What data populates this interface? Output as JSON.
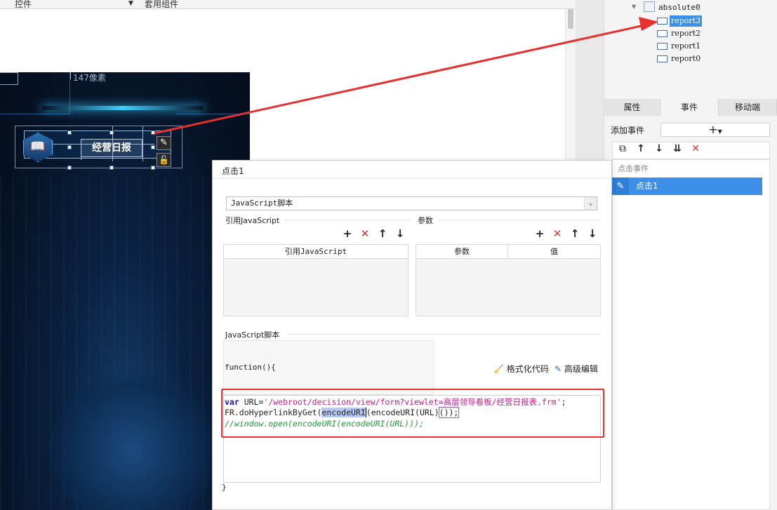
{
  "topbar": {
    "left_label": "控件",
    "right_label": "套用组件"
  },
  "canvas": {
    "pixel_label": "147像素"
  },
  "widget": {
    "title": "经营日报"
  },
  "tree": {
    "root": "absolute0",
    "items": [
      {
        "label": "report3",
        "selected": true
      },
      {
        "label": "report2",
        "selected": false
      },
      {
        "label": "report1",
        "selected": false
      },
      {
        "label": "report0",
        "selected": false
      }
    ]
  },
  "panel_tabs": [
    "属性",
    "事件",
    "移动端"
  ],
  "events": {
    "add_label": "添加事件",
    "group_label": "点击事件",
    "items": [
      "点击1"
    ]
  },
  "dialog": {
    "title": "点击1",
    "type_select": "JavaScript脚本",
    "ref_js_section": "引用JavaScript",
    "params_section": "参数",
    "ref_js_column": "引用JavaScript",
    "params_columns": [
      "参数",
      "值"
    ],
    "script_section": "JavaScript脚本",
    "function_decl": "function(){",
    "format_btn": "格式化代码",
    "advanced_btn": "高级编辑",
    "closing_brace": "}",
    "code": {
      "line1_kw": "var",
      "line1_mid": " URL=",
      "line1_str": "'/webroot/decision/view/form?viewlet=高层领导看板/经营日报表.frm'",
      "line1_end": ";",
      "line2_a": "FR.doHyperlinkByGet(",
      "line2_hl": "encodeURI",
      "line2_b": "(encodeURI(URL)",
      "line2_c": "());",
      "line3": "//window.open(encodeURI(encodeURI(URL)));"
    }
  },
  "colors": {
    "accent": "#3d8fe8",
    "annotation": "#e8302f",
    "danger": "#e03030"
  }
}
